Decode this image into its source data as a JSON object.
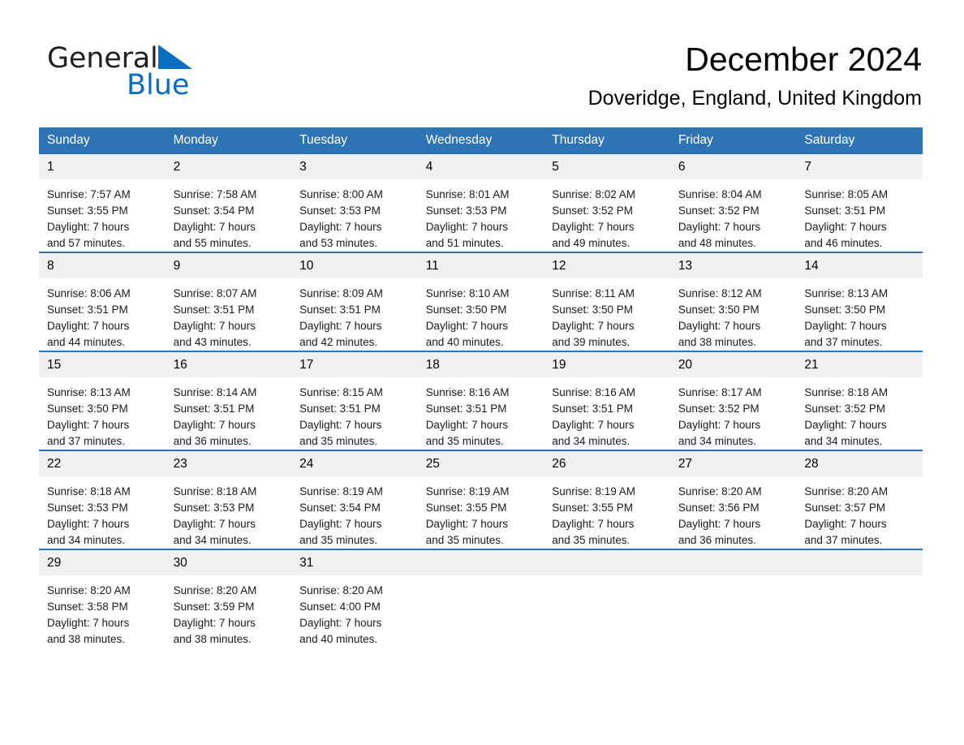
{
  "brand": {
    "name_part1": "General",
    "name_part2": "Blue",
    "triangle_color": "#0a6ec0"
  },
  "header": {
    "title": "December 2024",
    "subtitle": "Doveridge, England, United Kingdom"
  },
  "theme": {
    "header_blue": "#2e74b5",
    "daynum_gray": "#f0f0f0",
    "text_black": "#000000"
  },
  "calendar": {
    "weekdays": [
      "Sunday",
      "Monday",
      "Tuesday",
      "Wednesday",
      "Thursday",
      "Friday",
      "Saturday"
    ],
    "labels": {
      "sunrise": "Sunrise:",
      "sunset": "Sunset:",
      "daylight": "Daylight:"
    },
    "weeks": [
      [
        {
          "day": "1",
          "sunrise": "Sunrise: 7:57 AM",
          "sunset": "Sunset: 3:55 PM",
          "daylight_line1": "Daylight: 7 hours",
          "daylight_line2": "and 57 minutes."
        },
        {
          "day": "2",
          "sunrise": "Sunrise: 7:58 AM",
          "sunset": "Sunset: 3:54 PM",
          "daylight_line1": "Daylight: 7 hours",
          "daylight_line2": "and 55 minutes."
        },
        {
          "day": "3",
          "sunrise": "Sunrise: 8:00 AM",
          "sunset": "Sunset: 3:53 PM",
          "daylight_line1": "Daylight: 7 hours",
          "daylight_line2": "and 53 minutes."
        },
        {
          "day": "4",
          "sunrise": "Sunrise: 8:01 AM",
          "sunset": "Sunset: 3:53 PM",
          "daylight_line1": "Daylight: 7 hours",
          "daylight_line2": "and 51 minutes."
        },
        {
          "day": "5",
          "sunrise": "Sunrise: 8:02 AM",
          "sunset": "Sunset: 3:52 PM",
          "daylight_line1": "Daylight: 7 hours",
          "daylight_line2": "and 49 minutes."
        },
        {
          "day": "6",
          "sunrise": "Sunrise: 8:04 AM",
          "sunset": "Sunset: 3:52 PM",
          "daylight_line1": "Daylight: 7 hours",
          "daylight_line2": "and 48 minutes."
        },
        {
          "day": "7",
          "sunrise": "Sunrise: 8:05 AM",
          "sunset": "Sunset: 3:51 PM",
          "daylight_line1": "Daylight: 7 hours",
          "daylight_line2": "and 46 minutes."
        }
      ],
      [
        {
          "day": "8",
          "sunrise": "Sunrise: 8:06 AM",
          "sunset": "Sunset: 3:51 PM",
          "daylight_line1": "Daylight: 7 hours",
          "daylight_line2": "and 44 minutes."
        },
        {
          "day": "9",
          "sunrise": "Sunrise: 8:07 AM",
          "sunset": "Sunset: 3:51 PM",
          "daylight_line1": "Daylight: 7 hours",
          "daylight_line2": "and 43 minutes."
        },
        {
          "day": "10",
          "sunrise": "Sunrise: 8:09 AM",
          "sunset": "Sunset: 3:51 PM",
          "daylight_line1": "Daylight: 7 hours",
          "daylight_line2": "and 42 minutes."
        },
        {
          "day": "11",
          "sunrise": "Sunrise: 8:10 AM",
          "sunset": "Sunset: 3:50 PM",
          "daylight_line1": "Daylight: 7 hours",
          "daylight_line2": "and 40 minutes."
        },
        {
          "day": "12",
          "sunrise": "Sunrise: 8:11 AM",
          "sunset": "Sunset: 3:50 PM",
          "daylight_line1": "Daylight: 7 hours",
          "daylight_line2": "and 39 minutes."
        },
        {
          "day": "13",
          "sunrise": "Sunrise: 8:12 AM",
          "sunset": "Sunset: 3:50 PM",
          "daylight_line1": "Daylight: 7 hours",
          "daylight_line2": "and 38 minutes."
        },
        {
          "day": "14",
          "sunrise": "Sunrise: 8:13 AM",
          "sunset": "Sunset: 3:50 PM",
          "daylight_line1": "Daylight: 7 hours",
          "daylight_line2": "and 37 minutes."
        }
      ],
      [
        {
          "day": "15",
          "sunrise": "Sunrise: 8:13 AM",
          "sunset": "Sunset: 3:50 PM",
          "daylight_line1": "Daylight: 7 hours",
          "daylight_line2": "and 37 minutes."
        },
        {
          "day": "16",
          "sunrise": "Sunrise: 8:14 AM",
          "sunset": "Sunset: 3:51 PM",
          "daylight_line1": "Daylight: 7 hours",
          "daylight_line2": "and 36 minutes."
        },
        {
          "day": "17",
          "sunrise": "Sunrise: 8:15 AM",
          "sunset": "Sunset: 3:51 PM",
          "daylight_line1": "Daylight: 7 hours",
          "daylight_line2": "and 35 minutes."
        },
        {
          "day": "18",
          "sunrise": "Sunrise: 8:16 AM",
          "sunset": "Sunset: 3:51 PM",
          "daylight_line1": "Daylight: 7 hours",
          "daylight_line2": "and 35 minutes."
        },
        {
          "day": "19",
          "sunrise": "Sunrise: 8:16 AM",
          "sunset": "Sunset: 3:51 PM",
          "daylight_line1": "Daylight: 7 hours",
          "daylight_line2": "and 34 minutes."
        },
        {
          "day": "20",
          "sunrise": "Sunrise: 8:17 AM",
          "sunset": "Sunset: 3:52 PM",
          "daylight_line1": "Daylight: 7 hours",
          "daylight_line2": "and 34 minutes."
        },
        {
          "day": "21",
          "sunrise": "Sunrise: 8:18 AM",
          "sunset": "Sunset: 3:52 PM",
          "daylight_line1": "Daylight: 7 hours",
          "daylight_line2": "and 34 minutes."
        }
      ],
      [
        {
          "day": "22",
          "sunrise": "Sunrise: 8:18 AM",
          "sunset": "Sunset: 3:53 PM",
          "daylight_line1": "Daylight: 7 hours",
          "daylight_line2": "and 34 minutes."
        },
        {
          "day": "23",
          "sunrise": "Sunrise: 8:18 AM",
          "sunset": "Sunset: 3:53 PM",
          "daylight_line1": "Daylight: 7 hours",
          "daylight_line2": "and 34 minutes."
        },
        {
          "day": "24",
          "sunrise": "Sunrise: 8:19 AM",
          "sunset": "Sunset: 3:54 PM",
          "daylight_line1": "Daylight: 7 hours",
          "daylight_line2": "and 35 minutes."
        },
        {
          "day": "25",
          "sunrise": "Sunrise: 8:19 AM",
          "sunset": "Sunset: 3:55 PM",
          "daylight_line1": "Daylight: 7 hours",
          "daylight_line2": "and 35 minutes."
        },
        {
          "day": "26",
          "sunrise": "Sunrise: 8:19 AM",
          "sunset": "Sunset: 3:55 PM",
          "daylight_line1": "Daylight: 7 hours",
          "daylight_line2": "and 35 minutes."
        },
        {
          "day": "27",
          "sunrise": "Sunrise: 8:20 AM",
          "sunset": "Sunset: 3:56 PM",
          "daylight_line1": "Daylight: 7 hours",
          "daylight_line2": "and 36 minutes."
        },
        {
          "day": "28",
          "sunrise": "Sunrise: 8:20 AM",
          "sunset": "Sunset: 3:57 PM",
          "daylight_line1": "Daylight: 7 hours",
          "daylight_line2": "and 37 minutes."
        }
      ],
      [
        {
          "day": "29",
          "sunrise": "Sunrise: 8:20 AM",
          "sunset": "Sunset: 3:58 PM",
          "daylight_line1": "Daylight: 7 hours",
          "daylight_line2": "and 38 minutes."
        },
        {
          "day": "30",
          "sunrise": "Sunrise: 8:20 AM",
          "sunset": "Sunset: 3:59 PM",
          "daylight_line1": "Daylight: 7 hours",
          "daylight_line2": "and 38 minutes."
        },
        {
          "day": "31",
          "sunrise": "Sunrise: 8:20 AM",
          "sunset": "Sunset: 4:00 PM",
          "daylight_line1": "Daylight: 7 hours",
          "daylight_line2": "and 40 minutes."
        },
        {
          "day": "",
          "sunrise": "",
          "sunset": "",
          "daylight_line1": "",
          "daylight_line2": ""
        },
        {
          "day": "",
          "sunrise": "",
          "sunset": "",
          "daylight_line1": "",
          "daylight_line2": ""
        },
        {
          "day": "",
          "sunrise": "",
          "sunset": "",
          "daylight_line1": "",
          "daylight_line2": ""
        },
        {
          "day": "",
          "sunrise": "",
          "sunset": "",
          "daylight_line1": "",
          "daylight_line2": ""
        }
      ]
    ]
  }
}
